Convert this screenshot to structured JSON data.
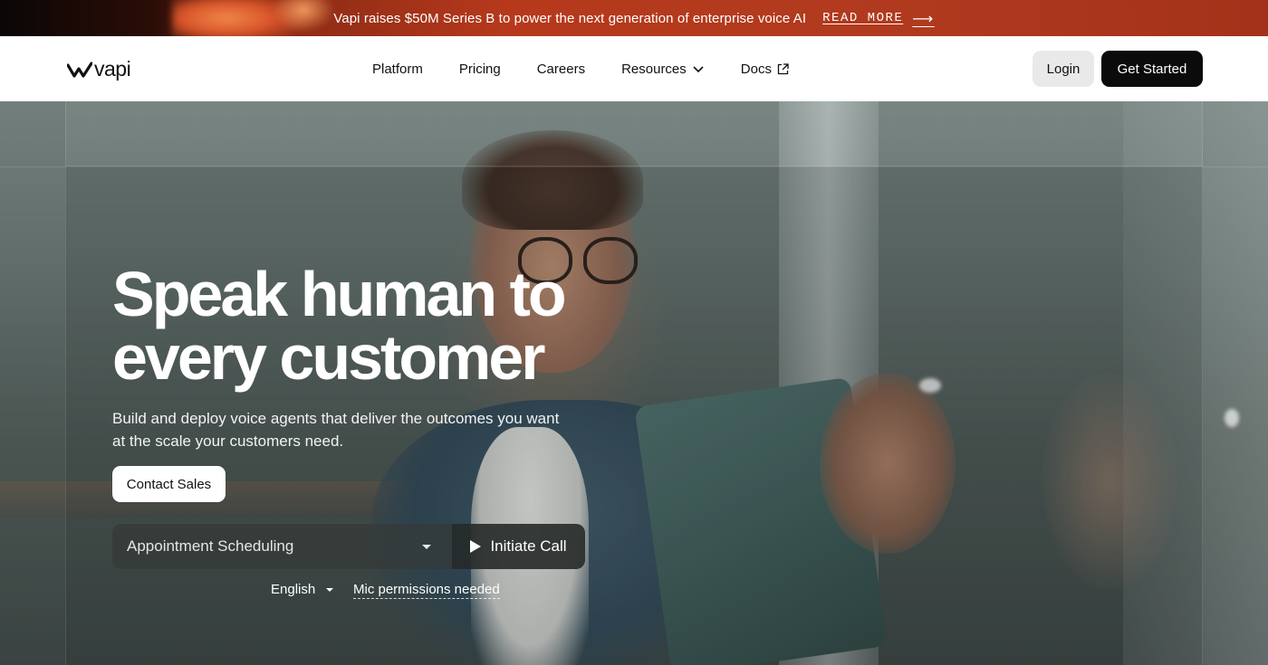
{
  "announcement": {
    "message": "Vapi raises $50M Series B to power the next generation of enterprise voice AI",
    "link_label": "READ MORE",
    "arrow": "⟶"
  },
  "nav": {
    "logo_text": "vapi",
    "links": [
      {
        "label": "Platform"
      },
      {
        "label": "Pricing"
      },
      {
        "label": "Careers"
      },
      {
        "label": "Resources",
        "icon": "chevron-down-icon"
      },
      {
        "label": "Docs",
        "icon": "external-link-icon"
      }
    ],
    "login_label": "Login",
    "get_started_label": "Get Started"
  },
  "hero": {
    "headline": "Speak human to every customer",
    "subheadline": "Build and deploy voice agents that deliver the outcomes you want at the scale your customers need.",
    "contact_label": "Contact Sales",
    "scenario_value": "Appointment Scheduling",
    "initiate_label": "Initiate Call",
    "language_value": "English",
    "mic_notice": "Mic permissions needed"
  },
  "colors": {
    "announcement_bg": "#b6391c",
    "primary_button": "#0b0b0b",
    "secondary_button": "#e9e9e9"
  }
}
